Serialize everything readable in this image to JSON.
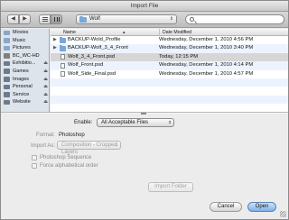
{
  "window": {
    "title": "Import File"
  },
  "toolbar": {
    "location": "Wolf",
    "search_placeholder": ""
  },
  "sidebar": {
    "items": [
      {
        "label": "Movies",
        "icon": "movies-folder-icon",
        "color": "#8aa6c8",
        "eject": false
      },
      {
        "label": "Music",
        "icon": "music-folder-icon",
        "color": "#8aa6c8",
        "eject": false
      },
      {
        "label": "Pictures",
        "icon": "pictures-folder-icon",
        "color": "#8aa6c8",
        "eject": false
      },
      {
        "label": "BC_WC-HD",
        "icon": "drive-icon",
        "color": "#7f7f7f",
        "eject": false
      },
      {
        "label": "Exhibitio...",
        "icon": "network-drive-icon",
        "color": "#6c7a8a",
        "eject": true
      },
      {
        "label": "Games",
        "icon": "network-drive-icon",
        "color": "#6c7a8a",
        "eject": true
      },
      {
        "label": "Images",
        "icon": "network-drive-icon",
        "color": "#6c7a8a",
        "eject": true
      },
      {
        "label": "Personal",
        "icon": "network-drive-icon",
        "color": "#6c7a8a",
        "eject": true
      },
      {
        "label": "Service",
        "icon": "network-drive-icon",
        "color": "#6c7a8a",
        "eject": true
      },
      {
        "label": "Website",
        "icon": "network-drive-icon",
        "color": "#6c7a8a",
        "eject": true
      }
    ]
  },
  "filelist": {
    "col_name": "Name",
    "col_date": "Date Modified",
    "rows": [
      {
        "name": "BACKUP-Wold_Profile",
        "date": "Wednesday, December 1, 2010 4:56 PM",
        "kind": "folder",
        "selected": false
      },
      {
        "name": "BACKUP-Wolf_3_4_Front",
        "date": "Wednesday, December 1, 2010 3:40 PM",
        "kind": "folder",
        "selected": false
      },
      {
        "name": "Wolf_3_4_Front.psd",
        "date": "Today, 12:15 PM",
        "kind": "file",
        "selected": true
      },
      {
        "name": "Wolf_Front.psd",
        "date": "Wednesday, December 1, 2010 4:14 PM",
        "kind": "file",
        "selected": false
      },
      {
        "name": "Wolf_Side_Final.psd",
        "date": "Wednesday, December 1, 2010 4:57 PM",
        "kind": "file",
        "selected": false
      },
      {
        "name": "",
        "date": "",
        "kind": "",
        "selected": false
      },
      {
        "name": "",
        "date": "",
        "kind": "",
        "selected": false
      },
      {
        "name": "",
        "date": "",
        "kind": "",
        "selected": false
      },
      {
        "name": "",
        "date": "",
        "kind": "",
        "selected": false
      }
    ]
  },
  "options": {
    "enable_label": "Enable:",
    "enable_value": "All Acceptable Files",
    "format_label": "Format:",
    "format_value": "Photoshop",
    "import_as_label": "Import As:",
    "import_as_value": "Composition - Cropped Layers",
    "photoshop_sequence_label": "Photoshop Sequence",
    "force_alpha_label": "Force alphabetical order",
    "import_folder_label": "Import Folder"
  },
  "footer": {
    "cancel_label": "Cancel",
    "open_label": "Open"
  }
}
